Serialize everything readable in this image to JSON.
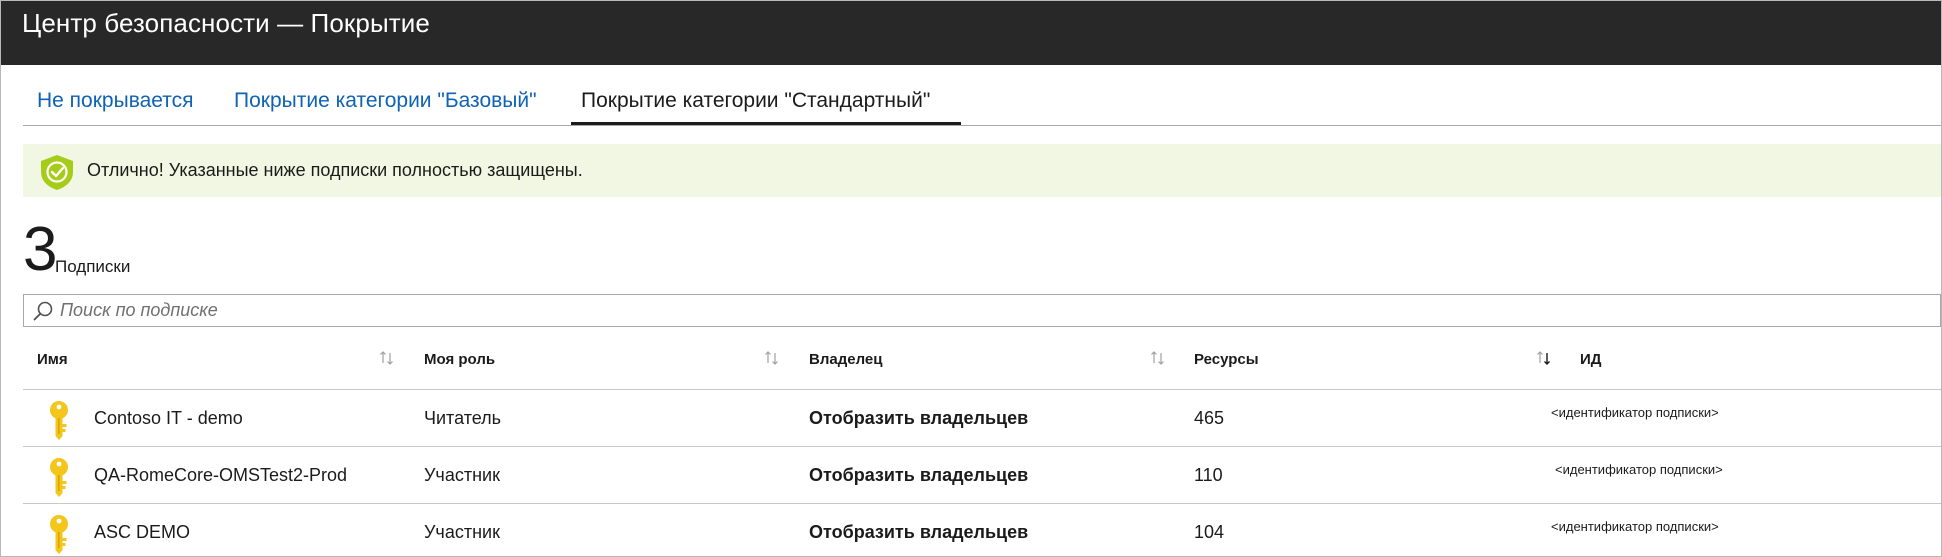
{
  "window": {
    "title": "Центр безопасности — Покрытие"
  },
  "tabs": [
    {
      "label": "Не покрывается",
      "active": false
    },
    {
      "label": "Покрытие категории \"Базовый\"",
      "active": false
    },
    {
      "label": "Покрытие категории \"Стандартный\"",
      "active": true
    }
  ],
  "banner": {
    "message": "Отлично! Указанные ниже подписки полностью защищены.",
    "icon": "shield-check-icon",
    "background": "#f1f7e2",
    "accent": "#a6cc1a"
  },
  "summary": {
    "count": "3",
    "label": "Подписки"
  },
  "search": {
    "placeholder": "Поиск по подписке",
    "value": ""
  },
  "table": {
    "columns": [
      {
        "label": "Имя",
        "sortable": true
      },
      {
        "label": "Моя роль",
        "sortable": true
      },
      {
        "label": "Владелец",
        "sortable": true
      },
      {
        "label": "Ресурсы",
        "sortable": true
      },
      {
        "label": "ИД",
        "sortable": false
      }
    ],
    "rows": [
      {
        "name": "Contoso IT - demo",
        "role": "Читатель",
        "owner": "Отобразить владельцев",
        "resources": "465",
        "id": "<идентификатор подписки>",
        "icon": "key-icon"
      },
      {
        "name": "QA-RomeCore-OMSTest2-Prod",
        "role": "Участник",
        "owner": "Отобразить владельцев",
        "resources": "110",
        "id": "<идентификатор подписки>",
        "icon": "key-icon"
      },
      {
        "name": "ASC DEMO",
        "role": "Участник",
        "owner": "Отобразить владельцев",
        "resources": "104",
        "id": "<идентификатор подписки>",
        "icon": "key-icon"
      }
    ]
  },
  "colors": {
    "titlebar": "#282828",
    "link": "#0f62b4",
    "key": "#f4c51a"
  }
}
